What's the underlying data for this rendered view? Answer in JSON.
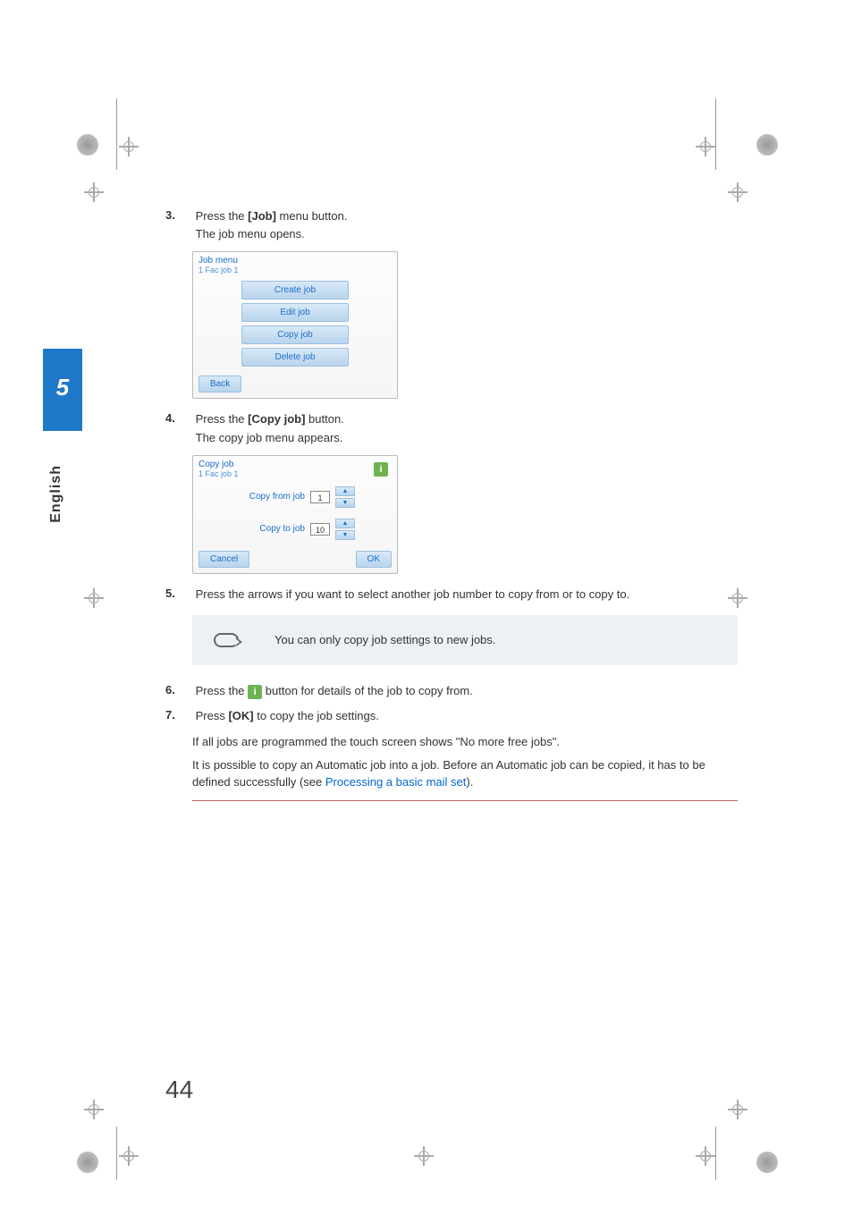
{
  "side": {
    "chapter": "5",
    "language": "English"
  },
  "page_number": "44",
  "steps": {
    "s3": {
      "num": "3.",
      "text_a": "Press the ",
      "bold": "[Job]",
      "text_b": " menu button.",
      "line2": "The job menu opens."
    },
    "s4": {
      "num": "4.",
      "text_a": "Press the ",
      "bold": "[Copy job]",
      "text_b": " button.",
      "line2": "The copy job menu appears."
    },
    "s5": {
      "num": "5.",
      "text": "Press the arrows if you want to select another job number to copy from or to copy to."
    },
    "s6": {
      "num": "6.",
      "text_a": "Press the ",
      "text_b": " button for details of the job to copy from."
    },
    "s7": {
      "num": "7.",
      "text_a": "Press ",
      "bold": "[OK]",
      "text_b": " to copy the job settings."
    }
  },
  "note": "You can only copy job settings to new jobs.",
  "post": {
    "line1": "If all jobs are programmed the touch screen shows \"No more free jobs\".",
    "line2a": "It is possible to copy an Automatic job into a job. Before an Automatic job can be copied, it has to be defined successfully (see ",
    "link": "Processing a basic mail set",
    "line2b": ")."
  },
  "screen1": {
    "title": "Job menu",
    "subtitle": "1 Fac job 1",
    "b1": "Create job",
    "b2": "Edit job",
    "b3": "Copy job",
    "b4": "Delete job",
    "back": "Back"
  },
  "screen2": {
    "title": "Copy job",
    "subtitle": "1 Fac job 1",
    "l1": "Copy from job",
    "v1": "1",
    "l2": "Copy to job",
    "v2": "10",
    "cancel": "Cancel",
    "ok": "OK",
    "info": "i"
  },
  "info_glyph": "i"
}
